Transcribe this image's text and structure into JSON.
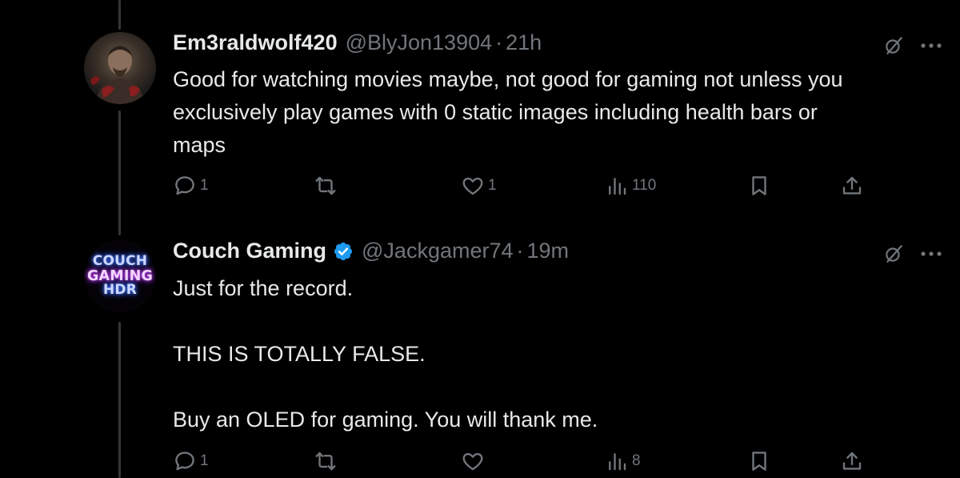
{
  "tweets": [
    {
      "display_name": "Em3raldwolf420",
      "handle": "@BlyJon13904",
      "separator": "·",
      "time": "21h",
      "verified": false,
      "text": [
        "Good for watching movies maybe, not good for gaming not unless you",
        "exclusively play games with 0 static images including health bars or",
        "maps"
      ],
      "actions": {
        "replies": "1",
        "reposts": "",
        "likes": "1",
        "views": "110"
      }
    },
    {
      "display_name": "Couch Gaming",
      "handle": "@Jackgamer74",
      "separator": "·",
      "time": "19m",
      "verified": true,
      "avatar_text": [
        "COUCH",
        "GAMING",
        "HDR"
      ],
      "text": [
        "Just for the record.",
        "THIS IS TOTALLY FALSE.",
        "Buy an OLED for gaming. You will thank me."
      ],
      "actions": {
        "replies": "1",
        "reposts": "",
        "likes": "",
        "views": "8"
      }
    }
  ],
  "colors": {
    "background": "#000000",
    "text_primary": "#e7e9ea",
    "text_secondary": "#71767b",
    "verified_badge": "#1d9bf0",
    "thread_line": "#333639"
  },
  "icons": {
    "reply": "reply-icon",
    "repost": "repost-icon",
    "like": "heart-icon",
    "views": "analytics-icon",
    "bookmark": "bookmark-icon",
    "share": "share-icon",
    "grok": "grok-icon",
    "more": "more-icon"
  }
}
